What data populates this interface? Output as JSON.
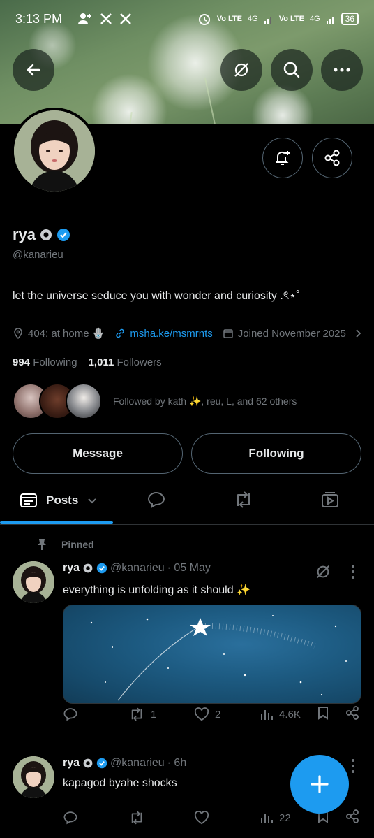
{
  "status_bar": {
    "time": "3:13 PM",
    "battery": "36",
    "network_1": "Vo LTE",
    "network_1_type": "4G",
    "network_2": "Vo LTE",
    "network_2_type": "4G"
  },
  "profile": {
    "name": "rya",
    "handle": "@kanarieu",
    "bio": "let the universe seduce you with wonder and curiosity .ৎ⋆˚",
    "location": "404: at home 🪬",
    "link": "msha.ke/msmrnts",
    "joined": "Joined November 2025",
    "following_count": "994",
    "following_label": "Following",
    "followers_count": "1,011",
    "followers_label": "Followers",
    "followed_by": "Followed by kath ✨, reu, L, and 62 others"
  },
  "buttons": {
    "message": "Message",
    "following": "Following"
  },
  "tabs": {
    "posts": "Posts"
  },
  "pinned_label": "Pinned",
  "posts": [
    {
      "name": "rya",
      "handle": "@kanarieu",
      "time": "· 05 May",
      "text": "everything is unfolding as it should ✨",
      "replies": "",
      "reposts": "1",
      "likes": "2",
      "views": "4.6K"
    },
    {
      "name": "rya",
      "handle": "@kanarieu",
      "time": "· 6h",
      "text": "kapagod byahe shocks",
      "replies": "",
      "reposts": "",
      "likes": "",
      "views": "22"
    }
  ],
  "icons": {
    "back": "back-arrow-icon",
    "grok": "grok-icon",
    "search": "search-icon",
    "more": "more-icon",
    "notify": "bell-plus-icon",
    "share": "share-icon"
  },
  "colors": {
    "accent": "#1d9bf0",
    "background": "#000000",
    "muted": "#71767b"
  }
}
